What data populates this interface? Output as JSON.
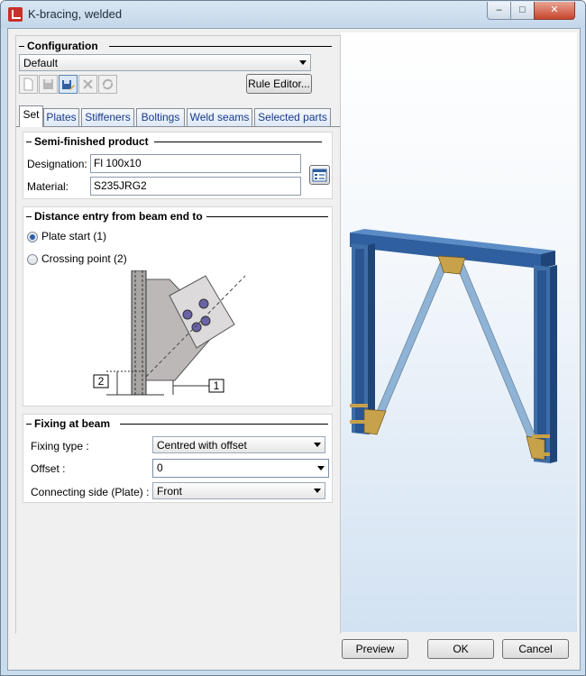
{
  "window": {
    "title": "K-bracing, welded",
    "minimize": "–",
    "maximize": "□",
    "close": "✕"
  },
  "configuration": {
    "heading": "Configuration",
    "selected": "Default",
    "rule_editor": "Rule Editor..."
  },
  "tabs": [
    "Set",
    "Plates",
    "Stiffeners",
    "Boltings",
    "Weld seams",
    "Selected parts"
  ],
  "semi": {
    "heading": "Semi-finished product",
    "designation_label": "Designation:",
    "designation_value": "Fl 100x10",
    "material_label": "Material:",
    "material_value": "S235JRG2"
  },
  "distance": {
    "heading": "Distance entry from beam end to",
    "option1": "Plate start (1)",
    "option2": "Crossing point (2)",
    "selected": "Plate start (1)",
    "marker1": "1",
    "marker2": "2"
  },
  "fixing": {
    "heading": "Fixing at beam",
    "type_label": "Fixing type :",
    "type_value": "Centred with offset",
    "offset_label": "Offset :",
    "offset_value": "0",
    "side_label": "Connecting side (Plate) :",
    "side_value": "Front"
  },
  "buttons": {
    "preview": "Preview",
    "ok": "OK",
    "cancel": "Cancel"
  },
  "colors": {
    "beam": "#3e6ea8",
    "plate": "#c8a24a",
    "brace": "#8fb3d4",
    "preview_bg": "#d2e2f2"
  }
}
